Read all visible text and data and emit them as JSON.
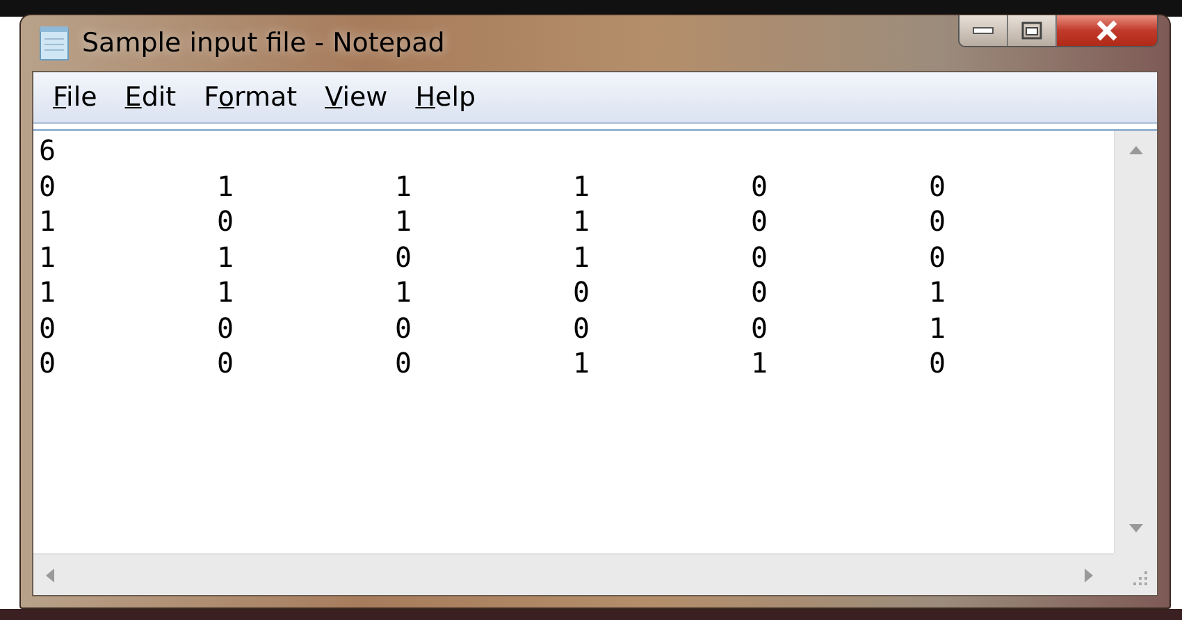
{
  "window": {
    "title": "Sample input file - Notepad"
  },
  "menu": [
    {
      "key": "F",
      "after": "ile"
    },
    {
      "key": "E",
      "after": "dit"
    },
    {
      "before": "F",
      "key": "o",
      "after": "rmat"
    },
    {
      "key": "V",
      "after": "iew"
    },
    {
      "key": "H",
      "after": "elp"
    }
  ],
  "text_lines": [
    "6",
    "0\t1\t1\t1\t0\t0",
    "1\t0\t1\t1\t0\t0",
    "1\t1\t0\t1\t0\t0",
    "1\t1\t1\t0\t0\t1",
    "0\t0\t0\t0\t0\t1",
    "0\t0\t0\t1\t1\t0"
  ]
}
